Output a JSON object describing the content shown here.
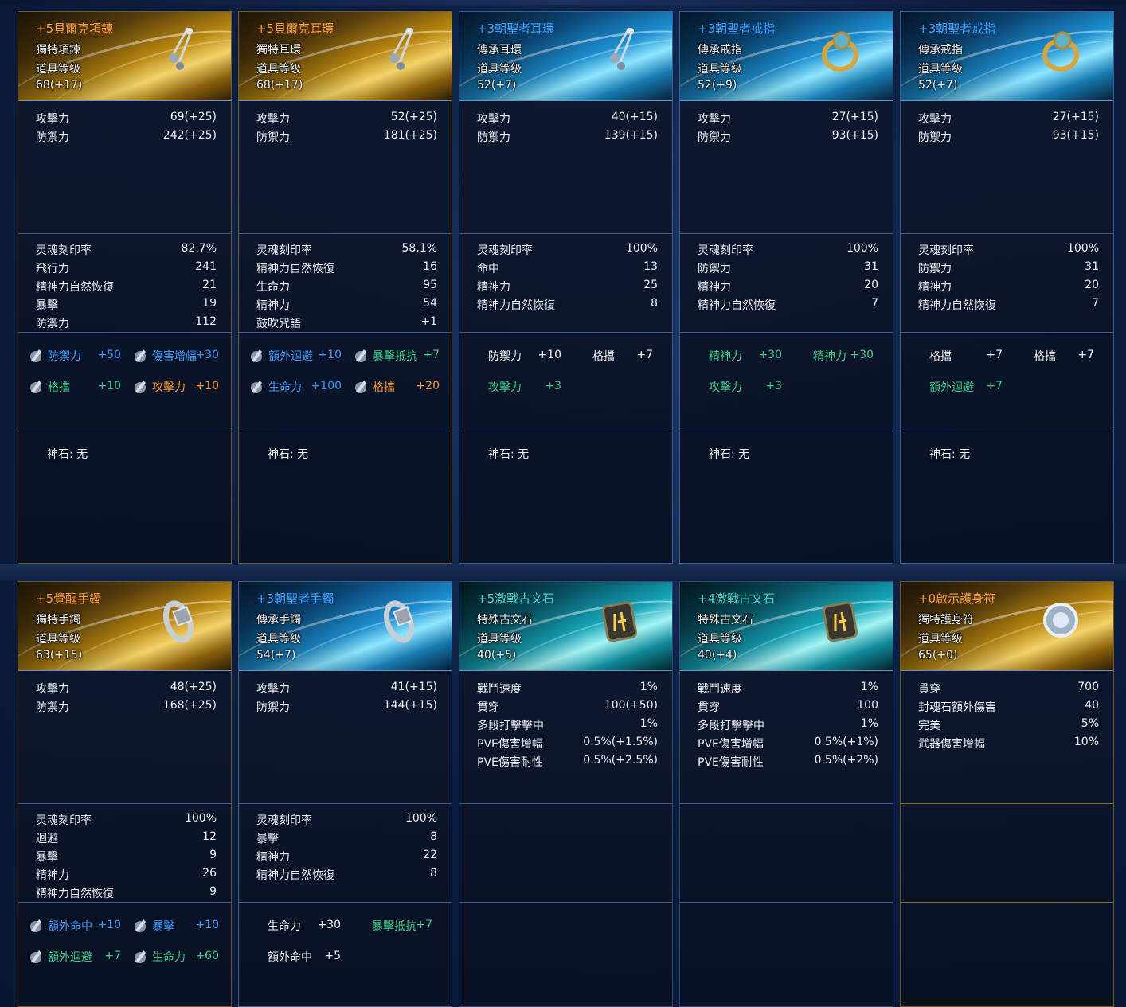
{
  "cards": [
    {
      "title": "+5貝爾克項鍊",
      "subtype": "獨特項鍊",
      "level_label": "道具等级",
      "level": "68(+17)",
      "base": [
        [
          "攻擊力",
          "69(+25)"
        ],
        [
          "防禦力",
          "242(+25)"
        ]
      ],
      "soul": [
        [
          "灵魂刻印率",
          "82.7%"
        ],
        [
          "飛行力",
          "241"
        ],
        [
          "精神力自然恢復",
          "21"
        ],
        [
          "暴擊",
          "19"
        ],
        [
          "防禦力",
          "112"
        ]
      ],
      "engrave": [
        {
          "name": "防禦力",
          "value": "+50",
          "color": "blue",
          "icon": true
        },
        {
          "name": "傷害增幅",
          "value": "+30",
          "color": "blue",
          "icon": true
        },
        {
          "name": "格擋",
          "value": "+10",
          "color": "green",
          "icon": true
        },
        {
          "name": "攻擊力",
          "value": "+10",
          "color": "orange",
          "icon": true
        }
      ],
      "god": "神石: 无"
    },
    {
      "title": "+5貝爾克耳環",
      "subtype": "獨特耳環",
      "level_label": "道具等级",
      "level": "68(+17)",
      "base": [
        [
          "攻擊力",
          "52(+25)"
        ],
        [
          "防禦力",
          "181(+25)"
        ]
      ],
      "soul": [
        [
          "灵魂刻印率",
          "58.1%"
        ],
        [
          "精神力自然恢復",
          "16"
        ],
        [
          "生命力",
          "95"
        ],
        [
          "精神力",
          "54"
        ],
        [
          "鼓吹咒語",
          "+1"
        ]
      ],
      "engrave": [
        {
          "name": "額外迴避",
          "value": "+10",
          "color": "blue",
          "icon": true
        },
        {
          "name": "暴擊抵抗",
          "value": "+7",
          "color": "green",
          "icon": true
        },
        {
          "name": "生命力",
          "value": "+100",
          "color": "blue",
          "icon": true
        },
        {
          "name": "格擋",
          "value": "+20",
          "color": "orange",
          "icon": true
        }
      ],
      "god": "神石: 无"
    },
    {
      "title": "+3朝聖者耳環",
      "subtype": "傳承耳環",
      "level_label": "道具等级",
      "level": "52(+7)",
      "base": [
        [
          "攻擊力",
          "40(+15)"
        ],
        [
          "防禦力",
          "139(+15)"
        ]
      ],
      "soul": [
        [
          "灵魂刻印率",
          "100%"
        ],
        [
          "命中",
          "13"
        ],
        [
          "精神力",
          "25"
        ],
        [
          "精神力自然恢復",
          "8"
        ]
      ],
      "engrave": [
        {
          "name": "防禦力",
          "value": "+10",
          "color": "white",
          "icon": false
        },
        {
          "name": "格擋",
          "value": "+7",
          "color": "white",
          "icon": false
        },
        {
          "name": "攻擊力",
          "value": "+3",
          "color": "green",
          "icon": false
        }
      ],
      "god": "神石: 无"
    },
    {
      "title": "+3朝聖者戒指",
      "subtype": "傳承戒指",
      "level_label": "道具等级",
      "level": "52(+9)",
      "base": [
        [
          "攻擊力",
          "27(+15)"
        ],
        [
          "防禦力",
          "93(+15)"
        ]
      ],
      "soul": [
        [
          "灵魂刻印率",
          "100%"
        ],
        [
          "防禦力",
          "31"
        ],
        [
          "精神力",
          "20"
        ],
        [
          "精神力自然恢復",
          "7"
        ]
      ],
      "engrave": [
        {
          "name": "精神力",
          "value": "+30",
          "color": "green",
          "icon": false
        },
        {
          "name": "精神力",
          "value": "+30",
          "color": "green",
          "icon": false
        },
        {
          "name": "攻擊力",
          "value": "+3",
          "color": "green",
          "icon": false
        }
      ],
      "god": "神石: 无"
    },
    {
      "title": "+3朝聖者戒指",
      "subtype": "傳承戒指",
      "level_label": "道具等级",
      "level": "52(+7)",
      "base": [
        [
          "攻擊力",
          "27(+15)"
        ],
        [
          "防禦力",
          "93(+15)"
        ]
      ],
      "soul": [
        [
          "灵魂刻印率",
          "100%"
        ],
        [
          "防禦力",
          "31"
        ],
        [
          "精神力",
          "20"
        ],
        [
          "精神力自然恢復",
          "7"
        ]
      ],
      "engrave": [
        {
          "name": "格擋",
          "value": "+7",
          "color": "white",
          "icon": false
        },
        {
          "name": "格擋",
          "value": "+7",
          "color": "white",
          "icon": false
        },
        {
          "name": "額外迴避",
          "value": "+7",
          "color": "green",
          "icon": false
        }
      ],
      "god": "神石: 无"
    },
    {
      "title": "+5覺醒手鐲",
      "subtype": "獨特手鐲",
      "level_label": "道具等级",
      "level": "63(+15)",
      "base": [
        [
          "攻擊力",
          "48(+25)"
        ],
        [
          "防禦力",
          "168(+25)"
        ]
      ],
      "soul": [
        [
          "灵魂刻印率",
          "100%"
        ],
        [
          "迴避",
          "12"
        ],
        [
          "暴擊",
          "9"
        ],
        [
          "精神力",
          "26"
        ],
        [
          "精神力自然恢復",
          "9"
        ]
      ],
      "engrave": [
        {
          "name": "額外命中",
          "value": "+10",
          "color": "blue",
          "icon": true
        },
        {
          "name": "暴擊",
          "value": "+10",
          "color": "blue",
          "icon": true
        },
        {
          "name": "額外迴避",
          "value": "+7",
          "color": "green",
          "icon": true
        },
        {
          "name": "生命力",
          "value": "+60",
          "color": "green",
          "icon": true
        }
      ],
      "god": ""
    },
    {
      "title": "+3朝聖者手鐲",
      "subtype": "傳承手鐲",
      "level_label": "道具等级",
      "level": "54(+7)",
      "base": [
        [
          "攻擊力",
          "41(+15)"
        ],
        [
          "防禦力",
          "144(+15)"
        ]
      ],
      "soul": [
        [
          "灵魂刻印率",
          "100%"
        ],
        [
          "暴擊",
          "8"
        ],
        [
          "精神力",
          "22"
        ],
        [
          "精神力自然恢復",
          "8"
        ]
      ],
      "engrave": [
        {
          "name": "生命力",
          "value": "+30",
          "color": "white",
          "icon": false
        },
        {
          "name": "暴擊抵抗",
          "value": "+7",
          "color": "green",
          "icon": false
        },
        {
          "name": "額外命中",
          "value": "+5",
          "color": "white",
          "icon": false
        }
      ],
      "god": ""
    },
    {
      "title": "+5激戰古文石",
      "subtype": "特殊古文石",
      "level_label": "道具等级",
      "level": "40(+5)",
      "base": [
        [
          "戰鬥速度",
          "1%"
        ],
        [
          "貫穿",
          "100(+50)"
        ],
        [
          "多段打擊擊中",
          "1%"
        ],
        [
          "PVE傷害增幅",
          "0.5%(+1.5%)"
        ],
        [
          "PVE傷害耐性",
          "0.5%(+2.5%)"
        ]
      ],
      "soul": [],
      "engrave": [],
      "god": ""
    },
    {
      "title": "+4激戰古文石",
      "subtype": "特殊古文石",
      "level_label": "道具等级",
      "level": "40(+4)",
      "base": [
        [
          "戰鬥速度",
          "1%"
        ],
        [
          "貫穿",
          "100"
        ],
        [
          "多段打擊擊中",
          "1%"
        ],
        [
          "PVE傷害增幅",
          "0.5%(+1%)"
        ],
        [
          "PVE傷害耐性",
          "0.5%(+2%)"
        ]
      ],
      "soul": [],
      "engrave": [],
      "god": ""
    },
    {
      "title": "+0啟示護身符",
      "subtype": "獨特護身符",
      "level_label": "道具等级",
      "level": "65(+0)",
      "base": [
        [
          "貫穿",
          "700"
        ],
        [
          "封魂石額外傷害",
          "40"
        ],
        [
          "完美",
          "5%"
        ],
        [
          "武器傷害增幅",
          "10%"
        ]
      ],
      "soul": [],
      "engrave": [],
      "god": ""
    }
  ],
  "colors": {
    "blue": "#3b9cff",
    "green": "#3ad08a",
    "orange": "#ff9a2e",
    "white": "#f2f2f2",
    "gold_title": "#ff9f3a",
    "blue_title": "#3fa2ff",
    "teal_title": "#4ed0c8"
  },
  "icons": [
    "necklace-icon",
    "earring-icon",
    "earring-icon",
    "ring-icon",
    "ring-icon",
    "bracelet-icon",
    "bracelet-icon",
    "runestone-icon",
    "runestone-icon",
    "amulet-icon"
  ]
}
